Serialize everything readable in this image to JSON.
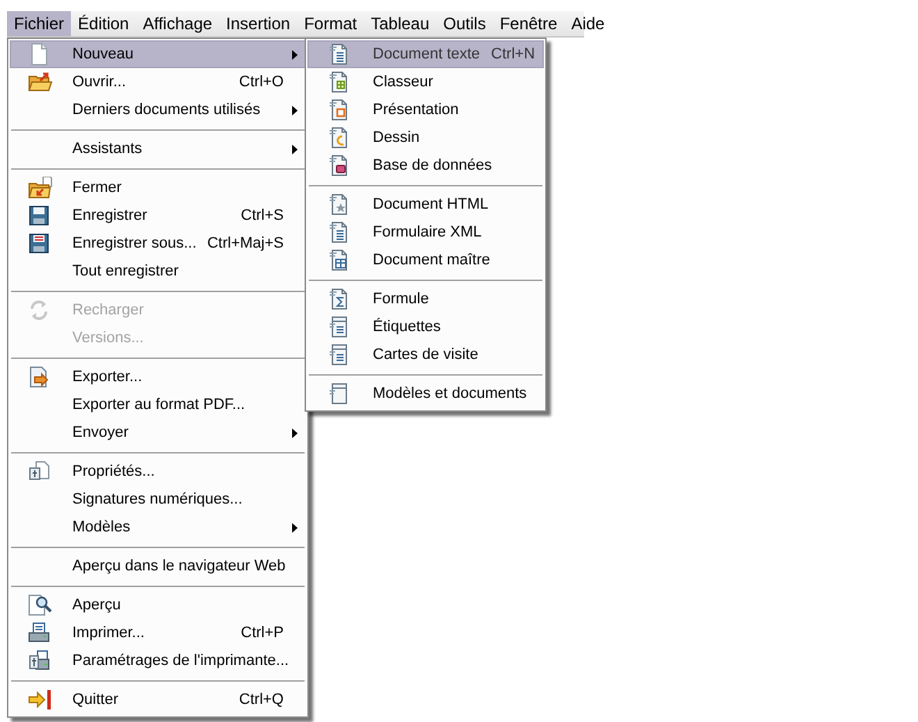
{
  "menubar": [
    {
      "label": "Fichier",
      "selected": true
    },
    {
      "label": "Édition",
      "selected": false
    },
    {
      "label": "Affichage",
      "selected": false
    },
    {
      "label": "Insertion",
      "selected": false
    },
    {
      "label": "Format",
      "selected": false
    },
    {
      "label": "Tableau",
      "selected": false
    },
    {
      "label": "Outils",
      "selected": false
    },
    {
      "label": "Fenêtre",
      "selected": false
    },
    {
      "label": "Aide",
      "selected": false
    }
  ],
  "menu": {
    "items": [
      {
        "kind": "page",
        "label": "Nouveau",
        "submenu": true,
        "selected": true,
        "disabled": false
      },
      {
        "kind": "folder",
        "label": "Ouvrir...",
        "shortcut": "Ctrl+O",
        "submenu": false,
        "selected": false,
        "disabled": false
      },
      {
        "kind": "plain",
        "label": "Derniers documents utilisés",
        "submenu": true,
        "selected": false,
        "disabled": false
      },
      {
        "kind": "separator"
      },
      {
        "kind": "plain",
        "label": "Assistants",
        "submenu": true,
        "selected": false,
        "disabled": false
      },
      {
        "kind": "separator"
      },
      {
        "kind": "close",
        "label": "Fermer",
        "submenu": false,
        "selected": false,
        "disabled": false
      },
      {
        "kind": "save",
        "label": "Enregistrer",
        "shortcut": "Ctrl+S",
        "submenu": false,
        "selected": false,
        "disabled": false
      },
      {
        "kind": "save-as",
        "label": "Enregistrer sous...",
        "shortcut": "Ctrl+Maj+S",
        "submenu": false,
        "selected": false,
        "disabled": false
      },
      {
        "kind": "plain",
        "label": "Tout enregistrer",
        "submenu": false,
        "selected": false,
        "disabled": false
      },
      {
        "kind": "separator"
      },
      {
        "kind": "reload",
        "label": "Recharger",
        "submenu": false,
        "selected": false,
        "disabled": true
      },
      {
        "kind": "plain",
        "label": "Versions...",
        "submenu": false,
        "selected": false,
        "disabled": true
      },
      {
        "kind": "separator"
      },
      {
        "kind": "export",
        "label": "Exporter...",
        "submenu": false,
        "selected": false,
        "disabled": false
      },
      {
        "kind": "plain",
        "label": "Exporter au format PDF...",
        "submenu": false,
        "selected": false,
        "disabled": false
      },
      {
        "kind": "plain",
        "label": "Envoyer",
        "submenu": true,
        "selected": false,
        "disabled": false
      },
      {
        "kind": "separator"
      },
      {
        "kind": "properties",
        "label": "Propriétés...",
        "submenu": false,
        "selected": false,
        "disabled": false
      },
      {
        "kind": "plain",
        "label": "Signatures numériques...",
        "submenu": false,
        "selected": false,
        "disabled": false
      },
      {
        "kind": "plain",
        "label": "Modèles",
        "submenu": true,
        "selected": false,
        "disabled": false
      },
      {
        "kind": "separator"
      },
      {
        "kind": "plain",
        "label": "Aperçu dans le navigateur Web",
        "submenu": false,
        "selected": false,
        "disabled": false
      },
      {
        "kind": "separator"
      },
      {
        "kind": "preview",
        "label": "Aperçu",
        "submenu": false,
        "selected": false,
        "disabled": false
      },
      {
        "kind": "print",
        "label": "Imprimer...",
        "shortcut": "Ctrl+P",
        "submenu": false,
        "selected": false,
        "disabled": false
      },
      {
        "kind": "printer-setup",
        "label": "Paramétrages de l'imprimante...",
        "submenu": false,
        "selected": false,
        "disabled": false
      },
      {
        "kind": "separator"
      },
      {
        "kind": "quit",
        "label": "Quitter",
        "shortcut": "Ctrl+Q",
        "submenu": false,
        "selected": false,
        "disabled": false
      }
    ]
  },
  "submenu": {
    "items": [
      {
        "kind": "text",
        "label": "Document texte",
        "shortcut": "Ctrl+N",
        "selected": true
      },
      {
        "kind": "spreadsheet",
        "label": "Classeur",
        "selected": false
      },
      {
        "kind": "presentation",
        "label": "Présentation",
        "selected": false
      },
      {
        "kind": "drawing",
        "label": "Dessin",
        "selected": false
      },
      {
        "kind": "database",
        "label": "Base de données",
        "selected": false
      },
      {
        "kind": "separator"
      },
      {
        "kind": "html",
        "label": "Document HTML",
        "selected": false
      },
      {
        "kind": "text",
        "label": "Formulaire XML",
        "selected": false
      },
      {
        "kind": "master",
        "label": "Document maître",
        "selected": false
      },
      {
        "kind": "separator"
      },
      {
        "kind": "formula",
        "label": "Formule",
        "selected": false
      },
      {
        "kind": "labels",
        "label": "Étiquettes",
        "selected": false
      },
      {
        "kind": "labels",
        "label": "Cartes de visite",
        "selected": false
      },
      {
        "kind": "separator"
      },
      {
        "kind": "templates",
        "label": "Modèles et documents",
        "selected": false
      }
    ]
  }
}
